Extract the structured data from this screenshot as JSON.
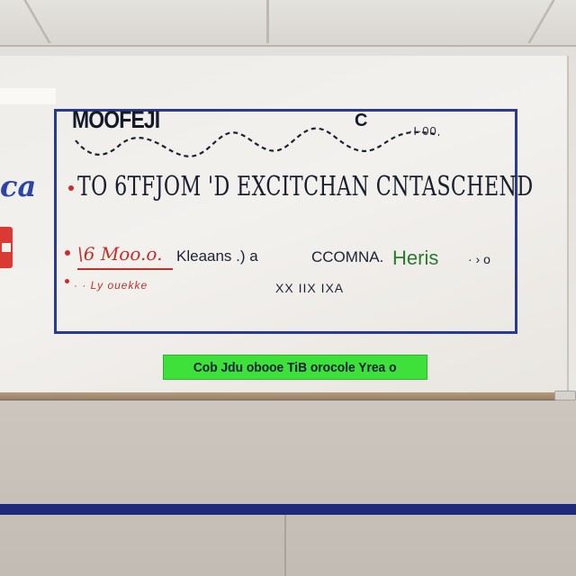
{
  "scene": {
    "board_title": "MOOFEJI",
    "board_corner_mark": "C",
    "board_corner_small": "·I·00",
    "left_edge_mark": "ca",
    "main_line": "TO 6TFJOM 'D EXCITCHAN CNTASCHEND",
    "red_note": "\\6 Moo.o.",
    "red_subnote": "· · Ly ouekke",
    "black_text_1": "Kleaans .) a",
    "black_text_2": "CCOMNA.",
    "green_word": "Heris",
    "after_green": "· › o",
    "sub_black_text": "XX  IIX IXA",
    "green_banner_text": "Cob Jdu obooe TiB orocole Yrea o",
    "colors": {
      "board_frame": "#2a3a8f",
      "red_marker": "#c2302c",
      "green_marker": "#2a7a2e",
      "banner_green": "#3de13a",
      "wall_stripe": "#1e2a7a"
    }
  }
}
